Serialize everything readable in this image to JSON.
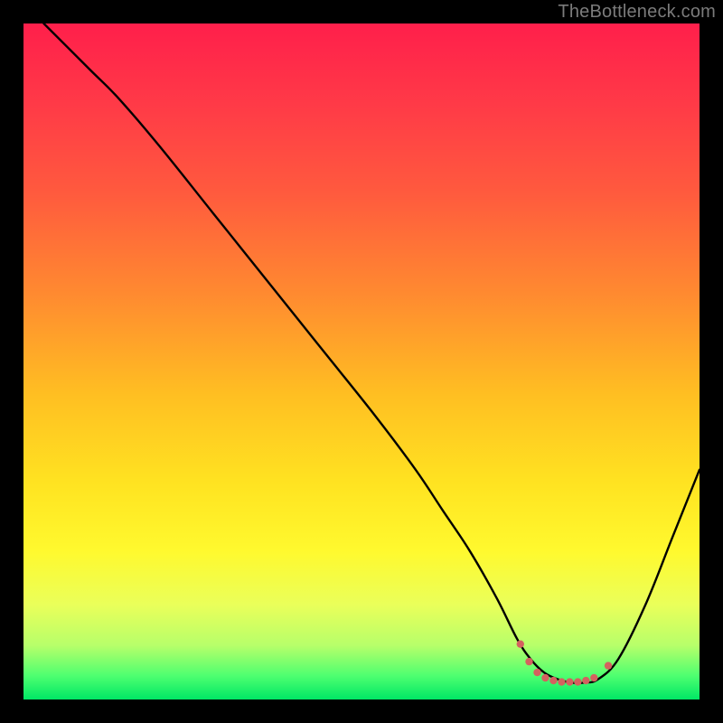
{
  "watermark": "TheBottleneck.com",
  "gradient": {
    "stops": [
      {
        "offset": 0.0,
        "color": "#ff1f4b"
      },
      {
        "offset": 0.12,
        "color": "#ff3a47"
      },
      {
        "offset": 0.25,
        "color": "#ff5a3e"
      },
      {
        "offset": 0.4,
        "color": "#ff8a30"
      },
      {
        "offset": 0.55,
        "color": "#ffbf22"
      },
      {
        "offset": 0.68,
        "color": "#ffe321"
      },
      {
        "offset": 0.78,
        "color": "#fff92e"
      },
      {
        "offset": 0.86,
        "color": "#eaff5a"
      },
      {
        "offset": 0.92,
        "color": "#b7ff6a"
      },
      {
        "offset": 0.965,
        "color": "#4eff70"
      },
      {
        "offset": 1.0,
        "color": "#00e765"
      }
    ]
  },
  "chart_data": {
    "type": "line",
    "title": "",
    "xlabel": "",
    "ylabel": "",
    "xlim": [
      0,
      100
    ],
    "ylim": [
      0,
      100
    ],
    "series": [
      {
        "name": "bottleneck-curve",
        "x": [
          3,
          6,
          10,
          14,
          20,
          28,
          36,
          44,
          52,
          58,
          62,
          66,
          70,
          73,
          75,
          77,
          79,
          81,
          83,
          85,
          88,
          92,
          96,
          100
        ],
        "y": [
          100,
          97,
          93,
          89,
          82,
          72,
          62,
          52,
          42,
          34,
          28,
          22,
          15,
          9,
          6,
          4,
          3,
          2.5,
          2.5,
          3,
          6,
          14,
          24,
          34
        ]
      }
    ],
    "markers": {
      "name": "optimal-range-dots",
      "color": "#d4615f",
      "radius": 4.2,
      "points": [
        {
          "x": 73.5,
          "y": 8.2
        },
        {
          "x": 74.8,
          "y": 5.6
        },
        {
          "x": 76.0,
          "y": 4.0
        },
        {
          "x": 77.2,
          "y": 3.2
        },
        {
          "x": 78.4,
          "y": 2.8
        },
        {
          "x": 79.6,
          "y": 2.6
        },
        {
          "x": 80.8,
          "y": 2.6
        },
        {
          "x": 82.0,
          "y": 2.6
        },
        {
          "x": 83.2,
          "y": 2.8
        },
        {
          "x": 84.4,
          "y": 3.2
        },
        {
          "x": 86.5,
          "y": 5.0
        }
      ]
    }
  }
}
